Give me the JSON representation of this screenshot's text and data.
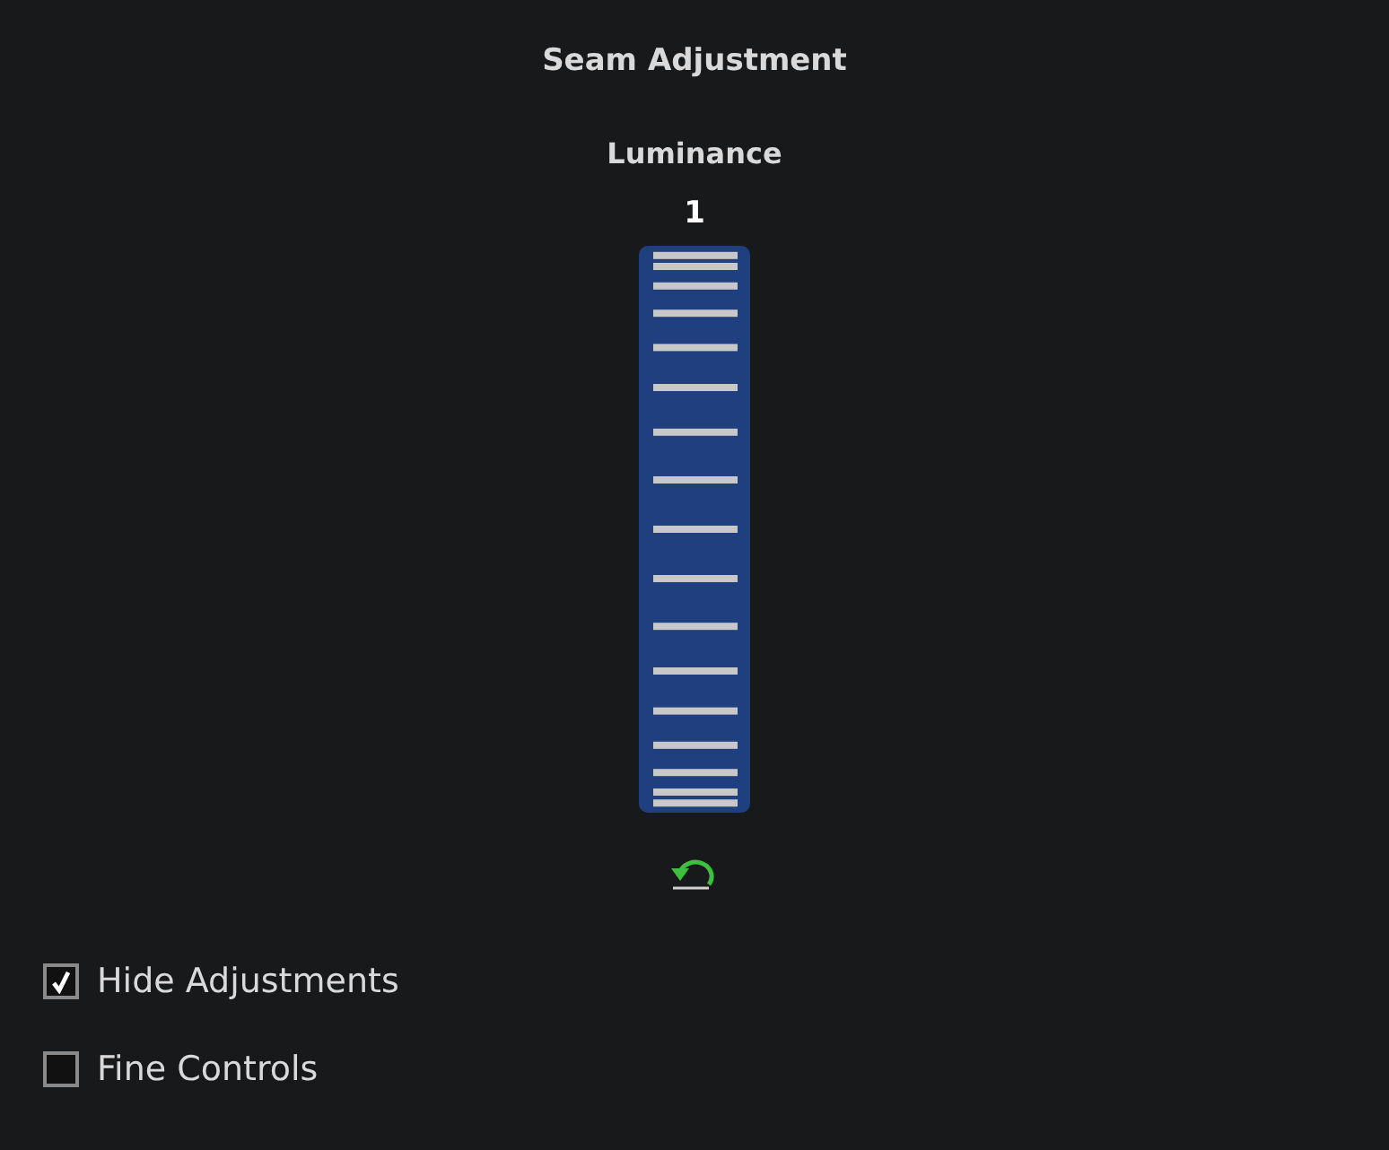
{
  "panel": {
    "title": "Seam Adjustment"
  },
  "wheel": {
    "label": "Luminance",
    "value": "1"
  },
  "options": [
    {
      "label": "Hide Adjustments",
      "checked": true
    },
    {
      "label": "Fine Controls",
      "checked": false
    }
  ]
}
